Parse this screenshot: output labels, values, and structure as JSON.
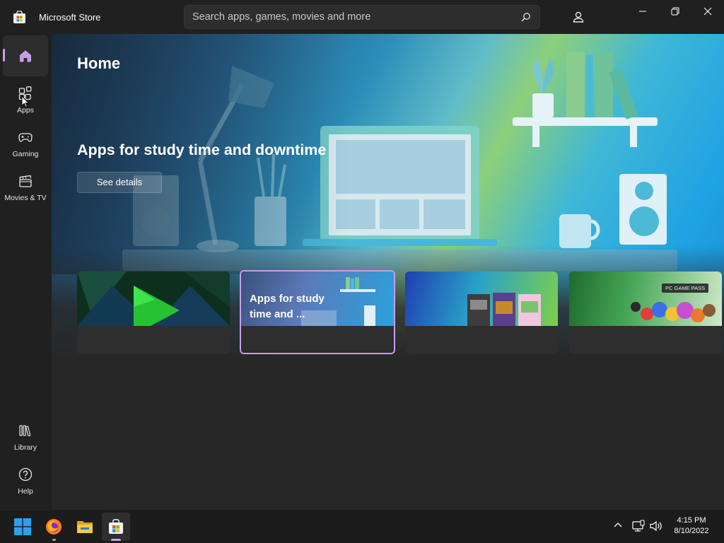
{
  "window": {
    "title": "Microsoft Store",
    "icon": "store-bag-icon"
  },
  "search": {
    "placeholder": "Search apps, games, movies and more",
    "value": ""
  },
  "sidebar": {
    "items": [
      {
        "label": "",
        "icon": "home-icon",
        "selected": true
      },
      {
        "label": "Apps",
        "icon": "apps-grid-icon"
      },
      {
        "label": "Gaming",
        "icon": "gamepad-icon"
      },
      {
        "label": "Movies & TV",
        "icon": "clapperboard-icon"
      }
    ],
    "bottom_items": [
      {
        "label": "Library",
        "icon": "library-icon"
      },
      {
        "label": "Help",
        "icon": "help-icon"
      }
    ]
  },
  "page": {
    "title": "Home"
  },
  "hero": {
    "heading": "Apps for study time and downtime",
    "button_label": "See details"
  },
  "carousel": {
    "cards": [
      {
        "text": "",
        "theme": "green-play"
      },
      {
        "text": "Apps for study time and ...",
        "theme": "study-apps",
        "selected": true
      },
      {
        "text": "",
        "theme": "games-boxes"
      },
      {
        "text": "",
        "theme": "pc-game-pass",
        "badge": "PC GAME PASS"
      }
    ]
  },
  "taskbar": {
    "icons": [
      "windows-start-icon",
      "firefox-icon",
      "file-explorer-icon",
      "microsoft-store-icon"
    ],
    "active": "microsoft-store-icon"
  },
  "clock": {
    "time": "4:15 PM",
    "date": "8/10/2022"
  },
  "colors": {
    "background": "#202020",
    "content": "#272727",
    "accent": "#c79ee8"
  }
}
